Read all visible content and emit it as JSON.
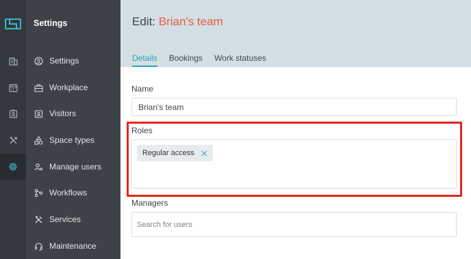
{
  "sidebar": {
    "title": "Settings",
    "items": [
      {
        "label": "Settings",
        "icon": "user-circle-icon"
      },
      {
        "label": "Workplace",
        "icon": "briefcase-icon"
      },
      {
        "label": "Visitors",
        "icon": "visitor-badge-icon"
      },
      {
        "label": "Space types",
        "icon": "shapes-icon"
      },
      {
        "label": "Manage users",
        "icon": "users-cog-icon"
      },
      {
        "label": "Workflows",
        "icon": "workflow-icon"
      },
      {
        "label": "Services",
        "icon": "tools-icon"
      },
      {
        "label": "Maintenance",
        "icon": "headset-icon"
      }
    ]
  },
  "rail": {
    "icons": [
      "app-logo-icon",
      "building-icon",
      "calendar-icon",
      "badge-icon",
      "tools-icon",
      "gear-icon"
    ],
    "active": "gear-icon"
  },
  "header": {
    "title_prefix": "Edit:",
    "title_name": "Brian's team"
  },
  "tabs": [
    {
      "label": "Details",
      "active": true
    },
    {
      "label": "Bookings",
      "active": false
    },
    {
      "label": "Work statuses",
      "active": false
    }
  ],
  "form": {
    "name_label": "Name",
    "name_value": "Brian's team",
    "roles_label": "Roles",
    "roles": [
      "Regular access"
    ],
    "managers_label": "Managers",
    "managers_placeholder": "Search for users"
  },
  "colors": {
    "accent": "#2a9fb7",
    "title_highlight": "#e45c4a",
    "annotation_box": "#e3271b",
    "rail_bg": "#33393e",
    "sidebar_bg": "#3c4247",
    "header_bg": "#d3dfe3"
  }
}
